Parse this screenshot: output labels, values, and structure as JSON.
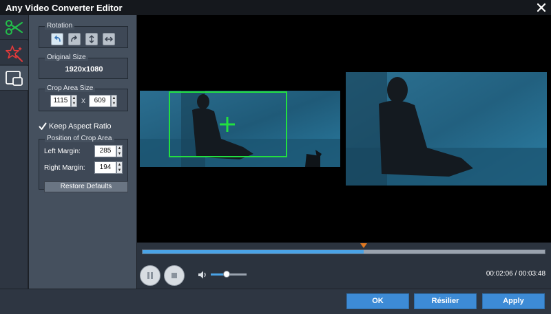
{
  "window": {
    "title": "Any Video Converter Editor"
  },
  "tabs": [
    {
      "icon": "scissors-icon",
      "active": false
    },
    {
      "icon": "effects-star-icon",
      "active": false
    },
    {
      "icon": "crop-icon",
      "active": true
    }
  ],
  "rotation": {
    "label": "Rotation",
    "buttons": [
      "rotate-left-icon",
      "rotate-right-icon",
      "flip-vertical-icon",
      "flip-horizontal-icon"
    ]
  },
  "original_size": {
    "label": "Original Size",
    "value": "1920x1080"
  },
  "crop_area_size": {
    "label": "Crop Area Size",
    "width": "1115",
    "separator": "X",
    "height": "609"
  },
  "keep_aspect": {
    "label": "Keep Aspect Ratio",
    "checked": true
  },
  "position": {
    "label": "Position of Crop Area",
    "left_label": "Left Margin:",
    "left_value": "285",
    "right_label": "Right Margin:",
    "right_value": "194"
  },
  "restore_label": "Restore Defaults",
  "playback": {
    "progress": 0.55,
    "volume": 0.45,
    "time": "00:02:06 / 00:03:48"
  },
  "footer": {
    "ok": "OK",
    "cancel": "Résilier",
    "apply": "Apply"
  },
  "colors": {
    "accent": "#3d8bd6",
    "crop_rect": "#22e040",
    "progress": "#4aa3e6",
    "marker": "#e07820"
  }
}
